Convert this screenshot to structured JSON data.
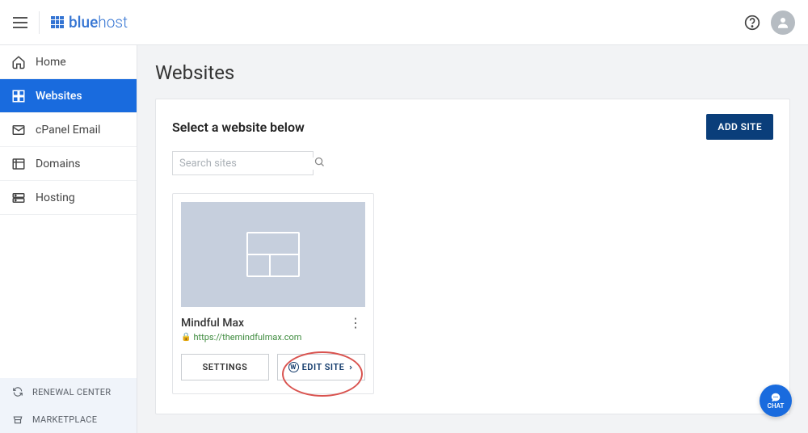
{
  "brand": {
    "name_bold": "blue",
    "name_thin": "host"
  },
  "sidebar": {
    "items": [
      {
        "label": "Home"
      },
      {
        "label": "Websites"
      },
      {
        "label": "cPanel Email"
      },
      {
        "label": "Domains"
      },
      {
        "label": "Hosting"
      }
    ],
    "bottom": [
      {
        "label": "RENEWAL CENTER"
      },
      {
        "label": "MARKETPLACE"
      }
    ]
  },
  "page": {
    "title": "Websites",
    "panel_title": "Select a website below",
    "add_button": "ADD SITE",
    "search_placeholder": "Search sites"
  },
  "site": {
    "name": "Mindful Max",
    "url": "https://themindfulmax.com",
    "settings_label": "SETTINGS",
    "edit_label": "EDIT SITE"
  },
  "chat": {
    "label": "CHAT"
  }
}
